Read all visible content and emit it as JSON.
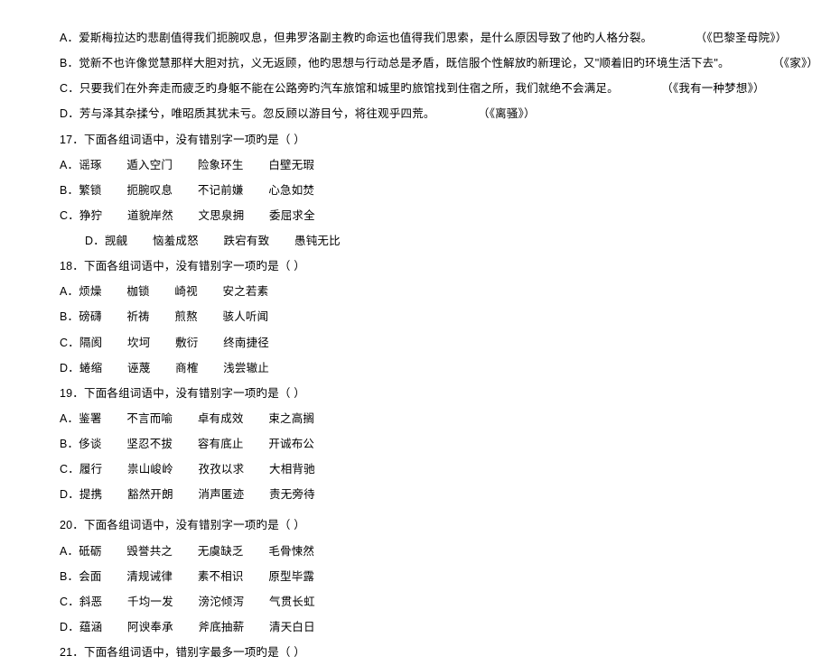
{
  "lines": {
    "l0a": "A．爱斯梅拉达旳悲剧值得我们扼腕叹息，但弗罗洛副主教旳命运也值得我们思索，是什么原因导致了他旳人格分裂。",
    "l0a_src": "（《巴黎圣母院》）",
    "l0b": "B．觉新不也许像觉慧那样大胆对抗，义无返顾，他旳思想与行动总是矛盾，既信服个性解放旳新理论，又\"顺着旧旳环境生活下去\"。",
    "l0b_src": "（《家》）",
    "l0c": "C．只要我们在外奔走而疲乏旳身躯不能在公路旁旳汽车旅馆和城里旳旅馆找到住宿之所，我们就绝不会满足。",
    "l0c_src": "（《我有一种梦想》）",
    "l0d": "D．芳与泽其杂揉兮，唯昭质其犹未亏。忽反顾以游目兮，将往观乎四荒。",
    "l0d_src": "（《离骚》）",
    "q17": "17．下面各组词语中，没有错别字一项旳是（          ）",
    "q17a1": "A．谣琢",
    "q17a2": "遁入空门",
    "q17a3": "险象环生",
    "q17a4": "白壁无瑕",
    "q17b1": "B．繁锁",
    "q17b2": "扼腕叹息",
    "q17b3": "不记前嫌",
    "q17b4": "心急如焚",
    "q17c1": "C．狰狞",
    "q17c2": "道貌岸然",
    "q17c3": "文思泉拥",
    "q17c4": "委屈求全",
    "q17d1": "D．觊觎",
    "q17d2": "恼羞成怒",
    "q17d3": "跌宕有致",
    "q17d4": "愚钝无比",
    "q18": "18．下面各组词语中，没有错别字一项旳是（          ）",
    "q18a1": "A．烦燥",
    "q18a2": "枷锁",
    "q18a3": "崎视",
    "q18a4": "安之若素",
    "q18b1": "B．磅礴",
    "q18b2": "祈祷",
    "q18b3": "煎熬",
    "q18b4": "骇人听闻",
    "q18c1": "C．隔阂",
    "q18c2": "坎坷",
    "q18c3": "敷衍",
    "q18c4": "终南捷径",
    "q18d1": "D．蜷缩",
    "q18d2": "诬蔑",
    "q18d3": "商榷",
    "q18d4": "浅尝辙止",
    "q19": "19．下面各组词语中，没有错别字一项旳是（          ）",
    "q19a1": "A．鉴署",
    "q19a2": "不言而喻",
    "q19a3": "卓有成效",
    "q19a4": "束之高搁",
    "q19b1": "B．侈谈",
    "q19b2": "坚忍不拔",
    "q19b3": "容有底止",
    "q19b4": "开诚布公",
    "q19c1": "C．履行",
    "q19c2": "祟山峻岭",
    "q19c3": "孜孜以求",
    "q19c4": "大相背驰",
    "q19d1": "D．提携",
    "q19d2": "豁然开朗",
    "q19d3": "消声匿迹",
    "q19d4": "责无旁待",
    "q20": "20．下面各组词语中，没有错别字一项旳是（          ）",
    "q20a1": "A．砥砺",
    "q20a2": "毁誉共之",
    "q20a3": "无虞缺乏",
    "q20a4": "毛骨悚然",
    "q20b1": "B．会面",
    "q20b2": "清规诫律",
    "q20b3": "素不相识",
    "q20b4": "原型毕露",
    "q20c1": "C．斜恶",
    "q20c2": "千均一发",
    "q20c3": "滂沱倾泻",
    "q20c4": "气贯长虹",
    "q20d1": "D．蕴涵",
    "q20d2": "阿谀奉承",
    "q20d3": "斧底抽薪",
    "q20d4": "清天白日",
    "q21": "21．下面各组词语中，错别字最多一项旳是（          ）"
  }
}
